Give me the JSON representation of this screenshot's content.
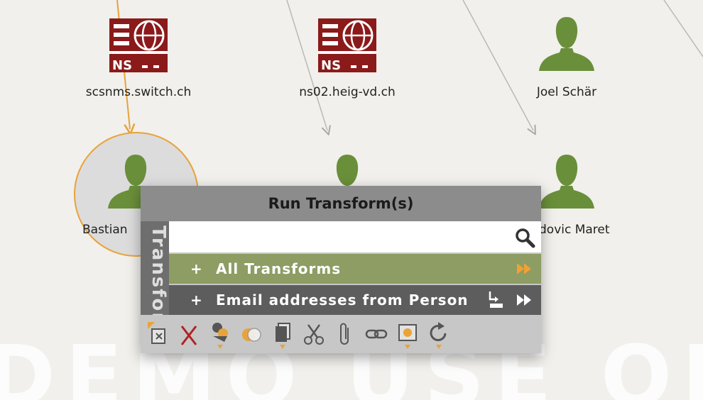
{
  "graph": {
    "nodes": [
      {
        "id": "ns1",
        "label": "scsnms.switch.ch",
        "icon": "ns-server-icon",
        "badge": "NS"
      },
      {
        "id": "ns2",
        "label": "ns02.heig-vd.ch",
        "icon": "ns-server-icon",
        "badge": "NS"
      },
      {
        "id": "p1",
        "label": "Joel Schär",
        "icon": "person-icon"
      },
      {
        "id": "p2",
        "label": "Bastian",
        "icon": "person-icon",
        "selected": true
      },
      {
        "id": "p3",
        "label": "",
        "icon": "person-icon"
      },
      {
        "id": "p4",
        "label": "dovic Maret",
        "icon": "person-icon"
      }
    ]
  },
  "watermark": "DEMO USE ONLY",
  "colors": {
    "person": "#6a8f3a",
    "ns_server": "#8b1a1a",
    "selection": "#e8a33a",
    "all_transforms_row": "#8d9d63",
    "popup_header": "#8c8c8c"
  },
  "popup": {
    "title": "Run Transform(s)",
    "side_tab": "Transforms",
    "search": {
      "value": "",
      "placeholder": ""
    },
    "rows": [
      {
        "plus": "+",
        "label": "All Transforms"
      },
      {
        "plus": "+",
        "label": "Email addresses from Person"
      }
    ],
    "toolbar_icons": [
      "change-type-icon",
      "delete-icon",
      "add-entity-icon",
      "merge-icon",
      "copy-icon",
      "cut-icon",
      "attach-icon",
      "link-icon",
      "bookmark-icon",
      "refresh-icon"
    ]
  }
}
